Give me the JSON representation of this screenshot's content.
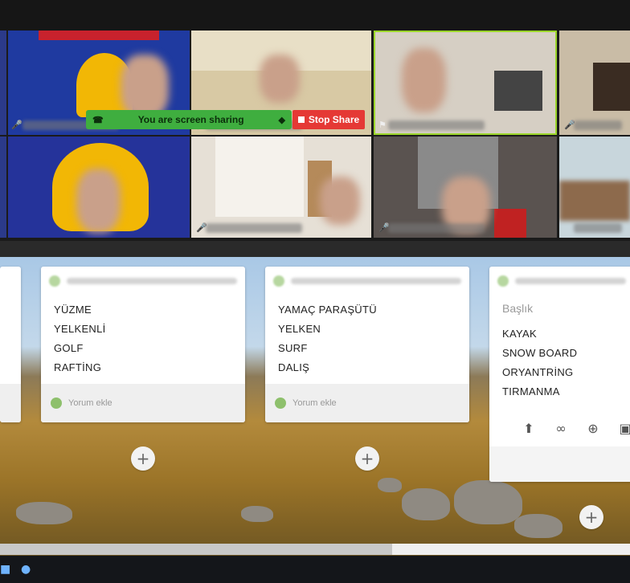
{
  "screen_share": {
    "status_text": "You are screen sharing",
    "stop_label": "Stop Share",
    "colors": {
      "bar": "#3fae3f",
      "stop": "#e53935"
    }
  },
  "board": {
    "cards": [
      {
        "items": [
          "YÜZME",
          "YELKENLİ",
          "GOLF",
          "RAFTİNG"
        ],
        "comment_label": "Yorum ekle"
      },
      {
        "items": [
          "YAMAÇ PARAŞÜTÜ",
          "YELKEN",
          "SURF",
          "DALIŞ"
        ],
        "comment_label": "Yorum ekle"
      },
      {
        "title_placeholder": "Başlık",
        "items": [
          "KAYAK",
          "SNOW BOARD",
          "ORYANTRİNG",
          "TIRMANMA"
        ],
        "tools": [
          "upload-icon",
          "link-icon",
          "search-icon",
          "camera-icon"
        ]
      }
    ]
  }
}
